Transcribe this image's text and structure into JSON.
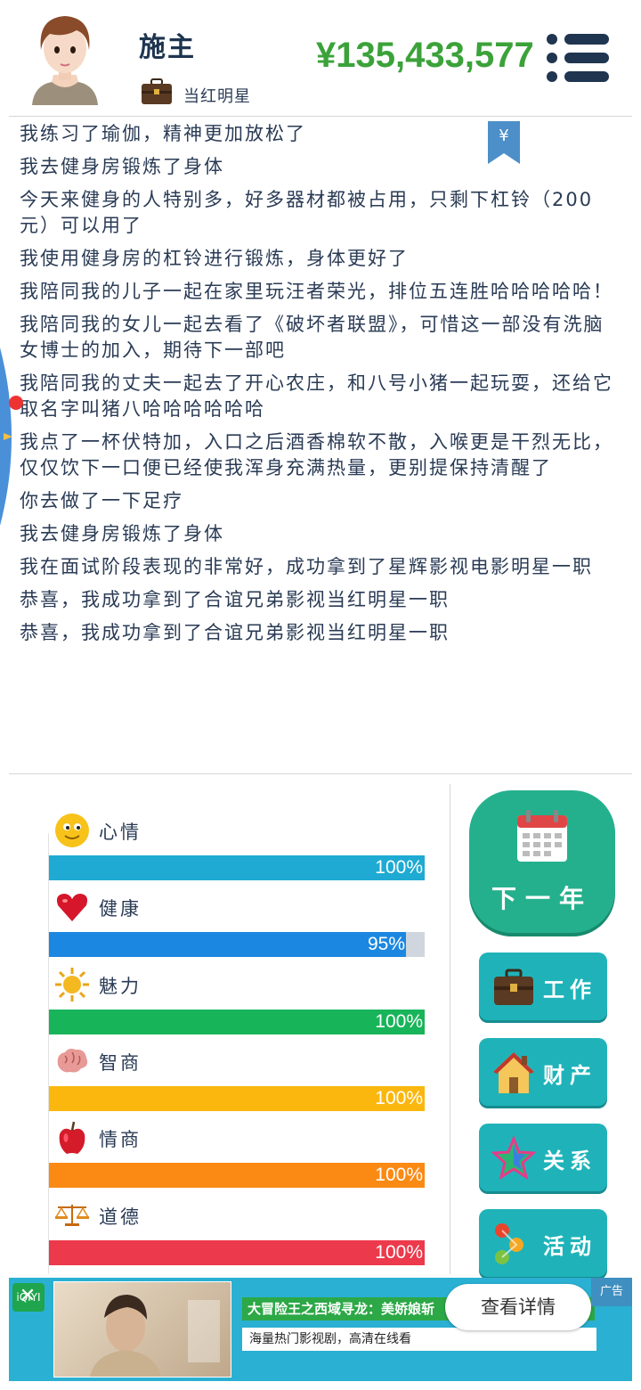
{
  "header": {
    "player_name": "施主",
    "job_title": "当红明星",
    "money": "¥135,433,577",
    "menu_icon": "hamburger-menu-icon"
  },
  "log": {
    "lines": [
      "我练习了瑜伽，精神更加放松了",
      "我去健身房锻炼了身体",
      "今天来健身的人特别多，好多器材都被占用，只剩下杠铃（200元）可以用了",
      "我使用健身房的杠铃进行锻炼，身体更好了",
      "我陪同我的儿子一起在家里玩汪者荣光，排位五连胜哈哈哈哈哈！",
      "我陪同我的女儿一起去看了《破坏者联盟》，可惜这一部没有洗脑女博士的加入，期待下一部吧",
      "我陪同我的丈夫一起去了开心农庄，和八号小猪一起玩耍，还给它取名字叫猪八哈哈哈哈哈哈",
      "我点了一杯伏特加，入口之后酒香棉软不散，入喉更是干烈无比，仅仅饮下一口便已经使我浑身充满热量，更别提保持清醒了",
      "你去做了一下足疗",
      "我去健身房锻炼了身体",
      "我在面试阶段表现的非常好，成功拿到了星辉影视电影明星一职",
      "恭喜，我成功拿到了合谊兄弟影视当红明星一职",
      "恭喜，我成功拿到了合谊兄弟影视当红明星一职"
    ],
    "bookmark_label": "¥"
  },
  "stats": [
    {
      "label": "心情",
      "icon": "smiley-icon",
      "value": 100,
      "pct": "100%",
      "color": "#1eaad3"
    },
    {
      "label": "健康",
      "icon": "heart-icon",
      "value": 95,
      "pct": "95%",
      "color": "#1c87e0"
    },
    {
      "label": "魅力",
      "icon": "sun-icon",
      "value": 100,
      "pct": "100%",
      "color": "#18b45a"
    },
    {
      "label": "智商",
      "icon": "brain-icon",
      "value": 100,
      "pct": "100%",
      "color": "#fbb70e"
    },
    {
      "label": "情商",
      "icon": "apple-icon",
      "value": 100,
      "pct": "100%",
      "color": "#fb8a14"
    },
    {
      "label": "道德",
      "icon": "scales-icon",
      "value": 100,
      "pct": "100%",
      "color": "#ec3a4c"
    }
  ],
  "actions": {
    "next_year": "下一年",
    "work": "工作",
    "property": "财产",
    "relations": "关系",
    "activities": "活动"
  },
  "ad": {
    "logo": "iQIYI",
    "title": "大冒险王之西域寻龙：美娇娘斩",
    "subtitle": "海量热门影视剧，高清在线看",
    "cta": "查看详情",
    "badge": "广告"
  }
}
